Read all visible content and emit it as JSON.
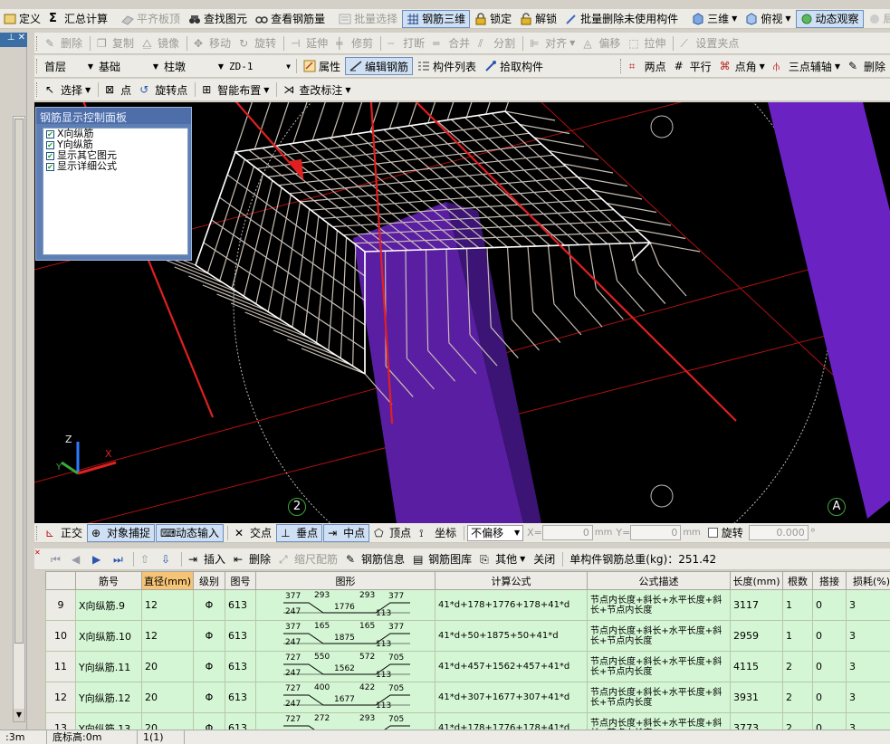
{
  "toolbar1": {
    "items": [
      {
        "label": "定义"
      },
      {
        "label": "汇总计算"
      },
      {
        "label": "平齐板顶",
        "disabled": true
      },
      {
        "label": "查找图元"
      },
      {
        "label": "查看钢筋量"
      },
      {
        "label": "批量选择",
        "disabled": true
      },
      {
        "label": "钢筋三维",
        "active": true
      },
      {
        "label": "锁定"
      },
      {
        "label": "解锁"
      },
      {
        "label": "批量删除未使用构件"
      },
      {
        "label": "三维"
      },
      {
        "label": "俯视"
      },
      {
        "label": "动态观察",
        "active": true
      },
      {
        "label": "局部"
      }
    ]
  },
  "toolbar2": {
    "items": [
      {
        "label": "删除"
      },
      {
        "label": "复制"
      },
      {
        "label": "镜像"
      },
      {
        "label": "移动"
      },
      {
        "label": "旋转"
      },
      {
        "label": "延伸"
      },
      {
        "label": "修剪"
      },
      {
        "label": "打断"
      },
      {
        "label": "合并"
      },
      {
        "label": "分割"
      },
      {
        "label": "对齐"
      },
      {
        "label": "偏移"
      },
      {
        "label": "拉伸"
      },
      {
        "label": "设置夹点"
      }
    ]
  },
  "toolbar3": {
    "floor": "首层",
    "category": "基础",
    "component_type": "柱墩",
    "component": "ZD-1",
    "attr_label": "属性",
    "edit_rebar_label": "编辑钢筋",
    "component_list_label": "构件列表",
    "pick_label": "拾取构件",
    "right_items": [
      {
        "label": "两点"
      },
      {
        "label": "平行"
      },
      {
        "label": "点角"
      },
      {
        "label": "三点辅轴"
      },
      {
        "label": "删除"
      }
    ]
  },
  "toolbar4": {
    "select_label": "选择",
    "point_label": "点",
    "rotate_point_label": "旋转点",
    "smart_layout_label": "智能布置",
    "modify_label_label": "查改标注"
  },
  "panel": {
    "title": "钢筋显示控制面板",
    "options": [
      {
        "label": "X向纵筋",
        "checked": true
      },
      {
        "label": "Y向纵筋",
        "checked": true
      },
      {
        "label": "显示其它图元",
        "checked": true
      },
      {
        "label": "显示详细公式",
        "checked": true
      }
    ]
  },
  "viewport": {
    "axis_x": "X",
    "axis_y": "Y",
    "axis_z": "Z",
    "grid_label_2": "2",
    "grid_label_a": "A"
  },
  "snapbar": {
    "orthogonal": "正交",
    "object_snap": "对象捕捉",
    "dynamic_input": "动态输入",
    "intersection": "交点",
    "perpendicular": "垂点",
    "midpoint": "中点",
    "vertex": "顶点",
    "coordinate": "坐标",
    "offset_mode": "不偏移",
    "x_label": "X=",
    "x_value": "0",
    "y_label": "Y=",
    "y_value": "0",
    "unit": "mm",
    "rotate_label": "旋转",
    "rotate_value": "0.000",
    "degree": "°"
  },
  "tablebar": {
    "insert": "插入",
    "delete": "删除",
    "scale_rebar": "缩尺配筋",
    "rebar_info": "钢筋信息",
    "rebar_library": "钢筋图库",
    "other": "其他",
    "close": "关闭",
    "total_weight": "单构件钢筋总重(kg)：251.42"
  },
  "table": {
    "headers": [
      "",
      "筋号",
      "直径(mm)",
      "级别",
      "图号",
      "图形",
      "计算公式",
      "公式描述",
      "长度(mm)",
      "根数",
      "搭接",
      "损耗(%)"
    ],
    "rows": [
      {
        "no": "9",
        "name": "X向纵筋.9",
        "dia": "12",
        "grade": "Φ",
        "fig": "613",
        "shape": {
          "a": "377",
          "b": "293",
          "c": "293",
          "d": "377",
          "e": "247",
          "f": "1776",
          "g": "113"
        },
        "formula": "41*d+178+1776+178+41*d",
        "desc": "节点内长度+斜长+水平长度+斜长+节点内长度",
        "length": "3117",
        "count": "1",
        "lap": "0",
        "loss": "3"
      },
      {
        "no": "10",
        "name": "X向纵筋.10",
        "dia": "12",
        "grade": "Φ",
        "fig": "613",
        "shape": {
          "a": "377",
          "b": "165",
          "c": "165",
          "d": "377",
          "e": "247",
          "f": "1875",
          "g": "113"
        },
        "formula": "41*d+50+1875+50+41*d",
        "desc": "节点内长度+斜长+水平长度+斜长+节点内长度",
        "length": "2959",
        "count": "1",
        "lap": "0",
        "loss": "3"
      },
      {
        "no": "11",
        "name": "Y向纵筋.11",
        "dia": "20",
        "grade": "Φ",
        "fig": "613",
        "shape": {
          "a": "727",
          "b": "550",
          "c": "572",
          "d": "705",
          "e": "247",
          "f": "1562",
          "g": "113"
        },
        "formula": "41*d+457+1562+457+41*d",
        "desc": "节点内长度+斜长+水平长度+斜长+节点内长度",
        "length": "4115",
        "count": "2",
        "lap": "0",
        "loss": "3"
      },
      {
        "no": "12",
        "name": "Y向纵筋.12",
        "dia": "20",
        "grade": "Φ",
        "fig": "613",
        "shape": {
          "a": "727",
          "b": "400",
          "c": "422",
          "d": "705",
          "e": "247",
          "f": "1677",
          "g": "113"
        },
        "formula": "41*d+307+1677+307+41*d",
        "desc": "节点内长度+斜长+水平长度+斜长+节点内长度",
        "length": "3931",
        "count": "2",
        "lap": "0",
        "loss": "3"
      },
      {
        "no": "13",
        "name": "Y向纵筋.13",
        "dia": "20",
        "grade": "Φ",
        "fig": "613",
        "shape": {
          "a": "727",
          "b": "272",
          "c": "293",
          "d": "705",
          "e": "",
          "f": "",
          "g": ""
        },
        "formula": "41*d+178+1776+178+41*d",
        "desc": "节点内长度+斜长+水平长度+斜长+节点内长度",
        "length": "3773",
        "count": "2",
        "lap": "0",
        "loss": "3"
      }
    ]
  },
  "statusbar": {
    "left": ":3m",
    "base_height": "底标高:0m",
    "count": "1(1)"
  }
}
